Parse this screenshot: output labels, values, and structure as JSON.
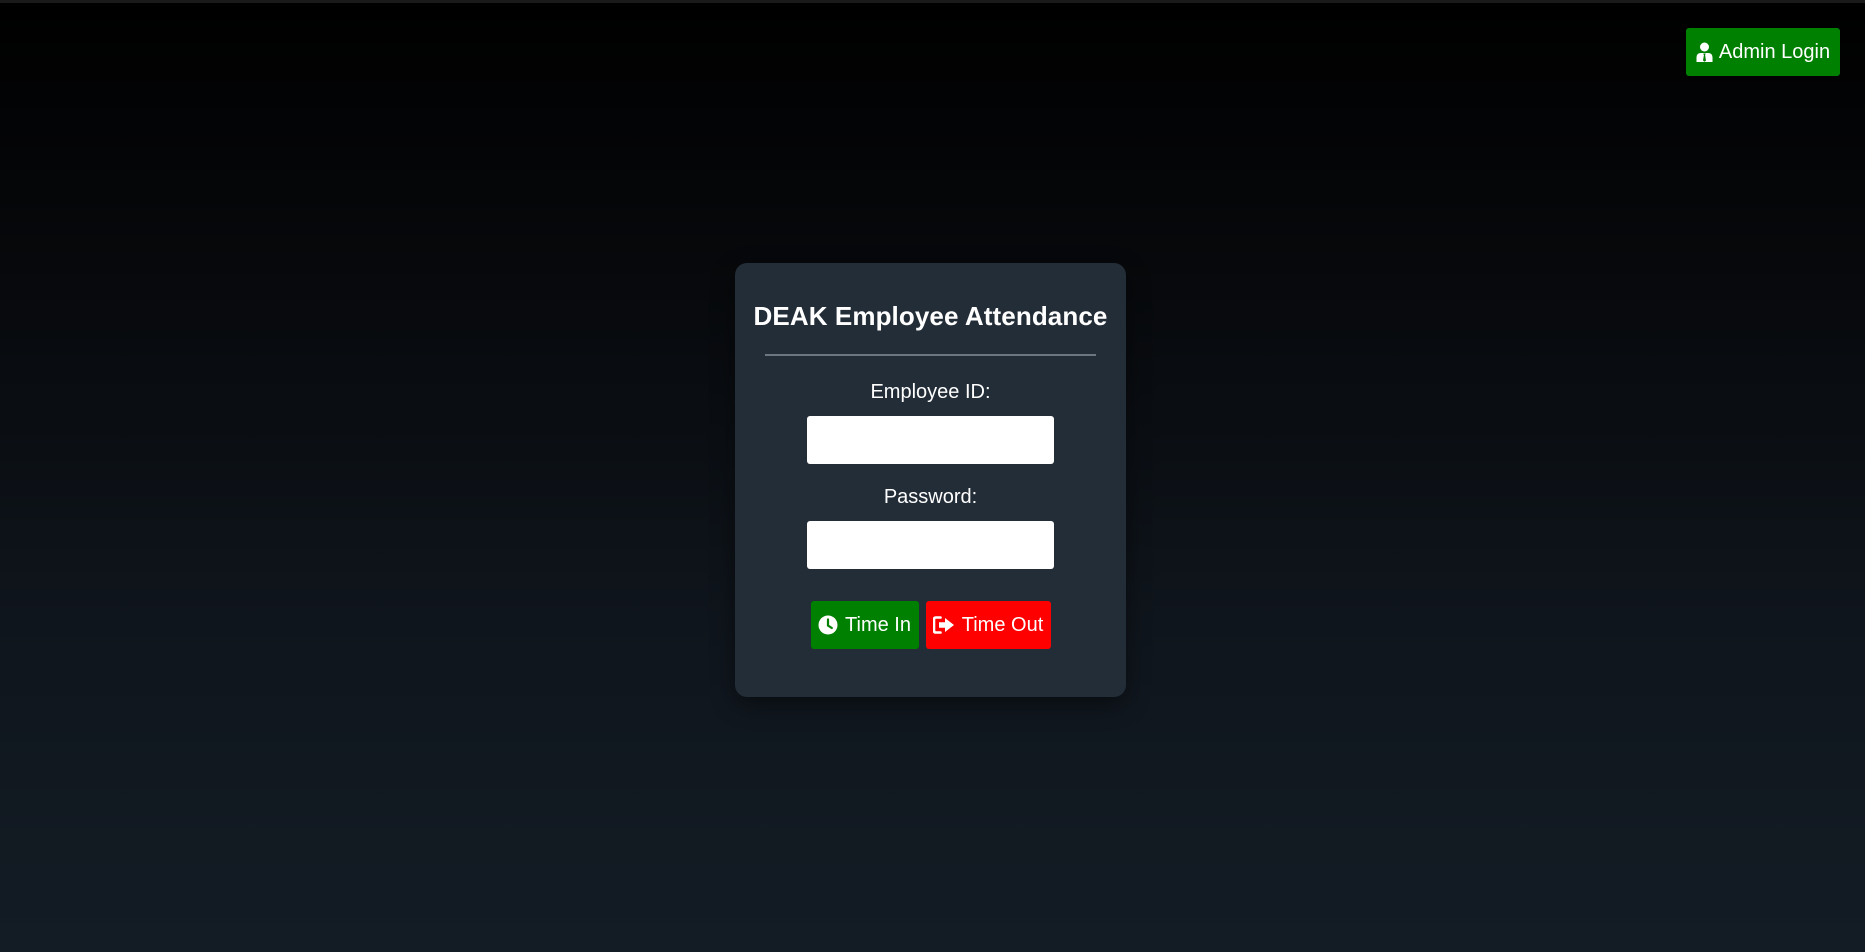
{
  "header": {
    "admin_login_label": "Admin Login",
    "admin_icon": "user-tie-icon"
  },
  "card": {
    "title": "DEAK Employee Attendance",
    "employee_id_label": "Employee ID:",
    "employee_id_value": "",
    "employee_id_placeholder": "",
    "password_label": "Password:",
    "password_value": "",
    "password_placeholder": "",
    "time_in_label": "Time In",
    "time_in_icon": "clock-icon",
    "time_out_label": "Time Out",
    "time_out_icon": "sign-out-icon"
  },
  "colors": {
    "primary_green": "#008000",
    "danger_red": "#ff0000",
    "card_bg": "#232d38"
  }
}
